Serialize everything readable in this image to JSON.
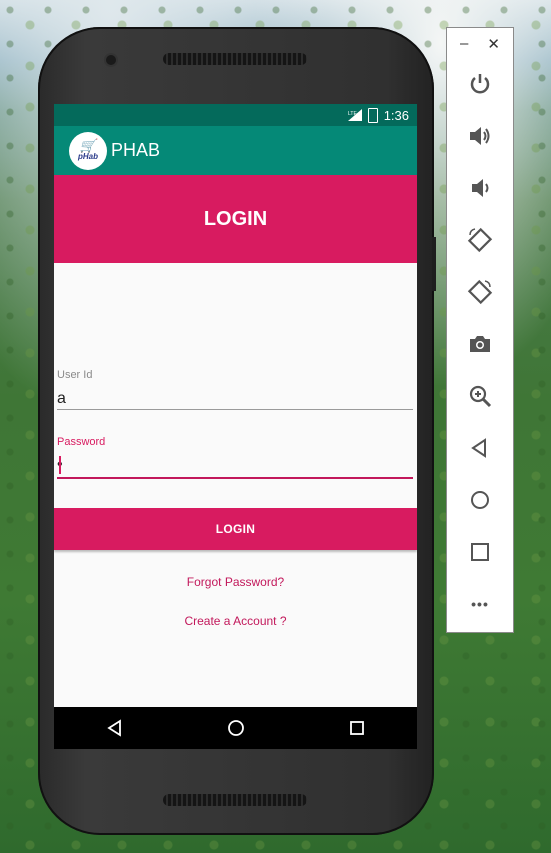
{
  "status_bar": {
    "network": "LTE",
    "time": "1:36"
  },
  "app_bar": {
    "logo_text": "pHab",
    "title": "PHAB"
  },
  "banner": {
    "title": "LOGIN"
  },
  "form": {
    "user_id": {
      "label": "User Id",
      "value": "a"
    },
    "password": {
      "label": "Password",
      "value": "•"
    },
    "login_button": "LOGIN",
    "forgot_link": "Forgot Password?",
    "create_link": "Create a Account ?"
  },
  "nav_bar": {
    "back": "back-icon",
    "home": "home-icon",
    "recents": "recents-icon"
  },
  "emulator_panel": {
    "window_controls": {
      "minimize": "–",
      "close": "✕"
    },
    "tools": [
      "power-icon",
      "volume-up-icon",
      "volume-down-icon",
      "rotate-left-icon",
      "rotate-right-icon",
      "camera-icon",
      "zoom-icon",
      "back-icon",
      "home-icon",
      "overview-icon",
      "more-icon"
    ],
    "more_label": "•••"
  },
  "colors": {
    "primary": "#058977",
    "primary_dark": "#046a5b",
    "accent": "#d81b60"
  }
}
